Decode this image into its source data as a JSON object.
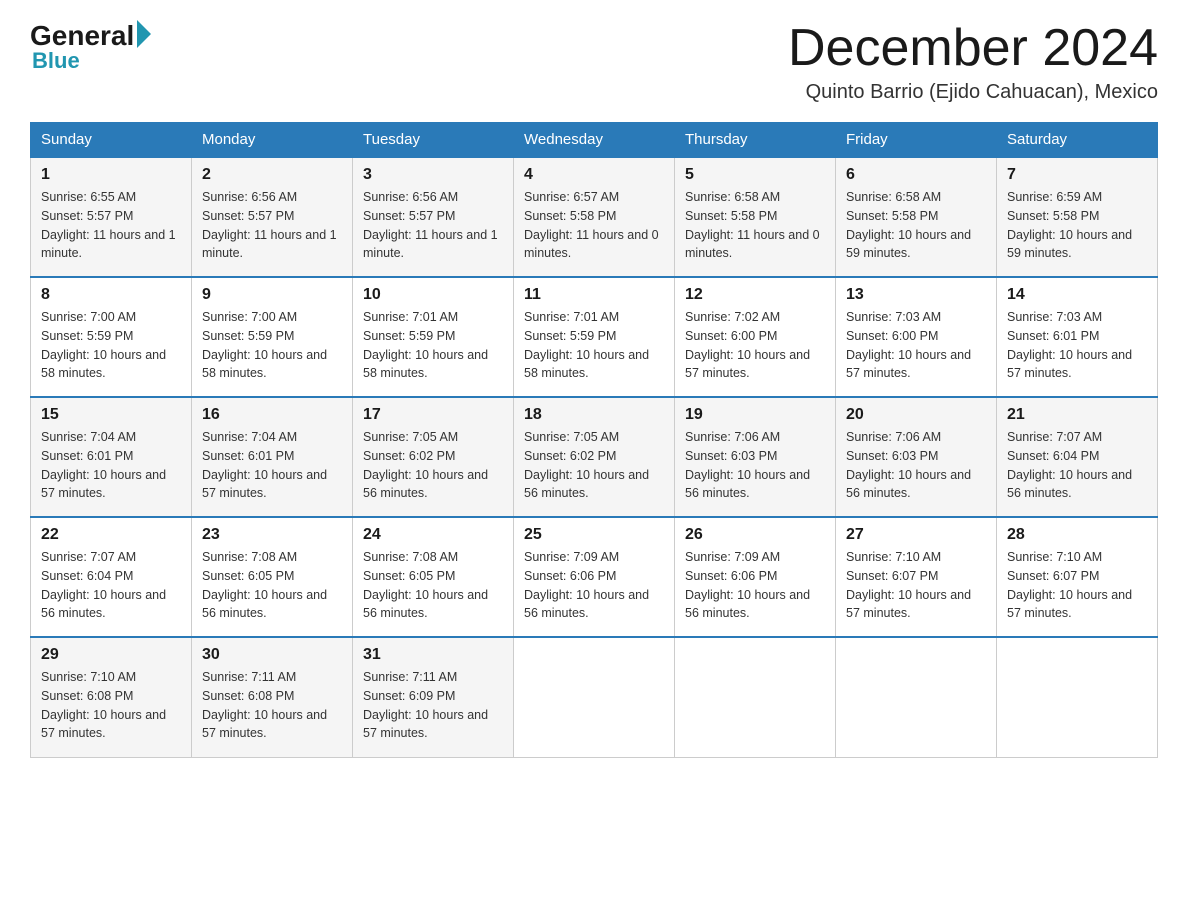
{
  "header": {
    "logo_text1": "General",
    "logo_text2": "Blue",
    "month_title": "December 2024",
    "location": "Quinto Barrio (Ejido Cahuacan), Mexico"
  },
  "weekdays": [
    "Sunday",
    "Monday",
    "Tuesday",
    "Wednesday",
    "Thursday",
    "Friday",
    "Saturday"
  ],
  "weeks": [
    [
      {
        "day": "1",
        "sunrise": "6:55 AM",
        "sunset": "5:57 PM",
        "daylight": "11 hours and 1 minute."
      },
      {
        "day": "2",
        "sunrise": "6:56 AM",
        "sunset": "5:57 PM",
        "daylight": "11 hours and 1 minute."
      },
      {
        "day": "3",
        "sunrise": "6:56 AM",
        "sunset": "5:57 PM",
        "daylight": "11 hours and 1 minute."
      },
      {
        "day": "4",
        "sunrise": "6:57 AM",
        "sunset": "5:58 PM",
        "daylight": "11 hours and 0 minutes."
      },
      {
        "day": "5",
        "sunrise": "6:58 AM",
        "sunset": "5:58 PM",
        "daylight": "11 hours and 0 minutes."
      },
      {
        "day": "6",
        "sunrise": "6:58 AM",
        "sunset": "5:58 PM",
        "daylight": "10 hours and 59 minutes."
      },
      {
        "day": "7",
        "sunrise": "6:59 AM",
        "sunset": "5:58 PM",
        "daylight": "10 hours and 59 minutes."
      }
    ],
    [
      {
        "day": "8",
        "sunrise": "7:00 AM",
        "sunset": "5:59 PM",
        "daylight": "10 hours and 58 minutes."
      },
      {
        "day": "9",
        "sunrise": "7:00 AM",
        "sunset": "5:59 PM",
        "daylight": "10 hours and 58 minutes."
      },
      {
        "day": "10",
        "sunrise": "7:01 AM",
        "sunset": "5:59 PM",
        "daylight": "10 hours and 58 minutes."
      },
      {
        "day": "11",
        "sunrise": "7:01 AM",
        "sunset": "5:59 PM",
        "daylight": "10 hours and 58 minutes."
      },
      {
        "day": "12",
        "sunrise": "7:02 AM",
        "sunset": "6:00 PM",
        "daylight": "10 hours and 57 minutes."
      },
      {
        "day": "13",
        "sunrise": "7:03 AM",
        "sunset": "6:00 PM",
        "daylight": "10 hours and 57 minutes."
      },
      {
        "day": "14",
        "sunrise": "7:03 AM",
        "sunset": "6:01 PM",
        "daylight": "10 hours and 57 minutes."
      }
    ],
    [
      {
        "day": "15",
        "sunrise": "7:04 AM",
        "sunset": "6:01 PM",
        "daylight": "10 hours and 57 minutes."
      },
      {
        "day": "16",
        "sunrise": "7:04 AM",
        "sunset": "6:01 PM",
        "daylight": "10 hours and 57 minutes."
      },
      {
        "day": "17",
        "sunrise": "7:05 AM",
        "sunset": "6:02 PM",
        "daylight": "10 hours and 56 minutes."
      },
      {
        "day": "18",
        "sunrise": "7:05 AM",
        "sunset": "6:02 PM",
        "daylight": "10 hours and 56 minutes."
      },
      {
        "day": "19",
        "sunrise": "7:06 AM",
        "sunset": "6:03 PM",
        "daylight": "10 hours and 56 minutes."
      },
      {
        "day": "20",
        "sunrise": "7:06 AM",
        "sunset": "6:03 PM",
        "daylight": "10 hours and 56 minutes."
      },
      {
        "day": "21",
        "sunrise": "7:07 AM",
        "sunset": "6:04 PM",
        "daylight": "10 hours and 56 minutes."
      }
    ],
    [
      {
        "day": "22",
        "sunrise": "7:07 AM",
        "sunset": "6:04 PM",
        "daylight": "10 hours and 56 minutes."
      },
      {
        "day": "23",
        "sunrise": "7:08 AM",
        "sunset": "6:05 PM",
        "daylight": "10 hours and 56 minutes."
      },
      {
        "day": "24",
        "sunrise": "7:08 AM",
        "sunset": "6:05 PM",
        "daylight": "10 hours and 56 minutes."
      },
      {
        "day": "25",
        "sunrise": "7:09 AM",
        "sunset": "6:06 PM",
        "daylight": "10 hours and 56 minutes."
      },
      {
        "day": "26",
        "sunrise": "7:09 AM",
        "sunset": "6:06 PM",
        "daylight": "10 hours and 56 minutes."
      },
      {
        "day": "27",
        "sunrise": "7:10 AM",
        "sunset": "6:07 PM",
        "daylight": "10 hours and 57 minutes."
      },
      {
        "day": "28",
        "sunrise": "7:10 AM",
        "sunset": "6:07 PM",
        "daylight": "10 hours and 57 minutes."
      }
    ],
    [
      {
        "day": "29",
        "sunrise": "7:10 AM",
        "sunset": "6:08 PM",
        "daylight": "10 hours and 57 minutes."
      },
      {
        "day": "30",
        "sunrise": "7:11 AM",
        "sunset": "6:08 PM",
        "daylight": "10 hours and 57 minutes."
      },
      {
        "day": "31",
        "sunrise": "7:11 AM",
        "sunset": "6:09 PM",
        "daylight": "10 hours and 57 minutes."
      },
      null,
      null,
      null,
      null
    ]
  ]
}
